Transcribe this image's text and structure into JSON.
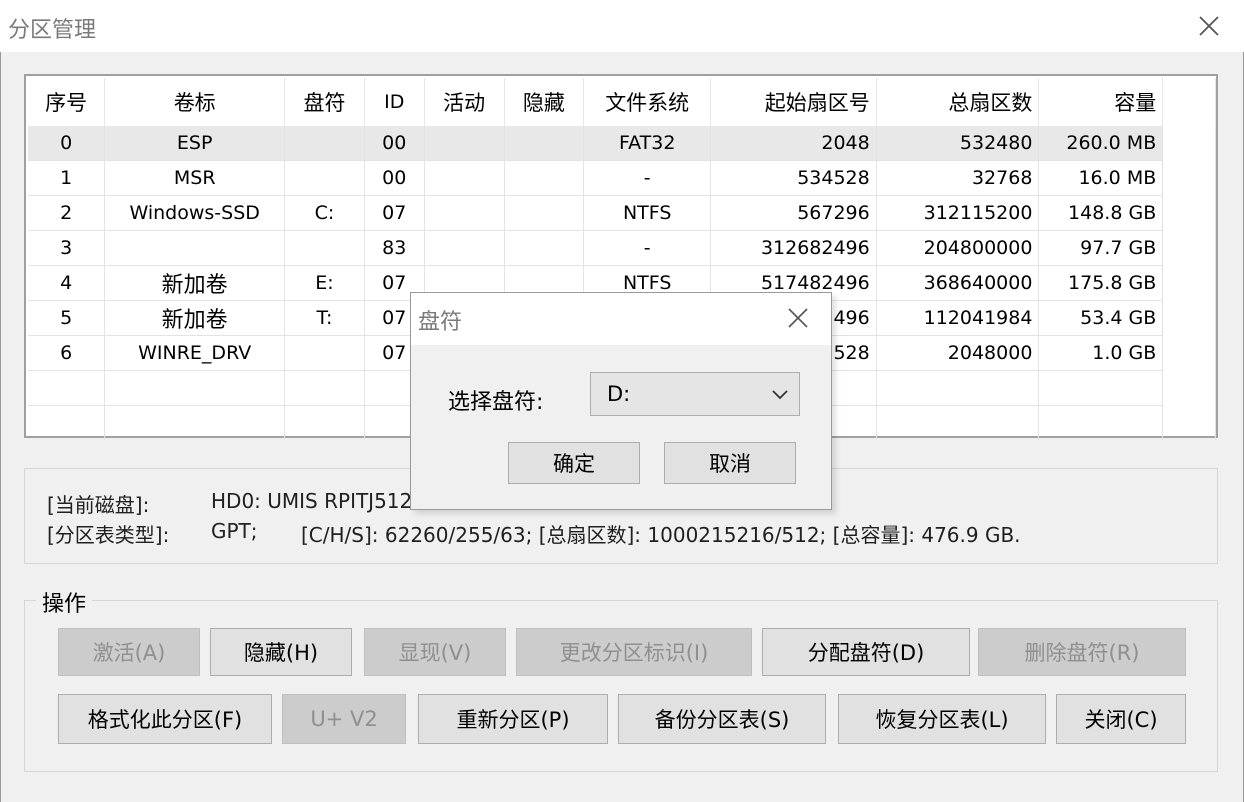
{
  "window": {
    "title": "分区管理"
  },
  "table": {
    "columns": [
      "序号",
      "卷标",
      "盘符",
      "ID",
      "活动",
      "隐藏",
      "文件系统",
      "起始扇区号",
      "总扇区数",
      "容量"
    ],
    "rows": [
      {
        "idx": "0",
        "label": "ESP",
        "drive": "",
        "id": "00",
        "active": "",
        "hidden": "",
        "fs": "FAT32",
        "start": "2048",
        "total": "532480",
        "size": "260.0 MB"
      },
      {
        "idx": "1",
        "label": "MSR",
        "drive": "",
        "id": "00",
        "active": "",
        "hidden": "",
        "fs": "-",
        "start": "534528",
        "total": "32768",
        "size": "16.0 MB"
      },
      {
        "idx": "2",
        "label": "Windows-SSD",
        "drive": "C:",
        "id": "07",
        "active": "",
        "hidden": "",
        "fs": "NTFS",
        "start": "567296",
        "total": "312115200",
        "size": "148.8 GB"
      },
      {
        "idx": "3",
        "label": "",
        "drive": "",
        "id": "83",
        "active": "",
        "hidden": "",
        "fs": "-",
        "start": "312682496",
        "total": "204800000",
        "size": "97.7 GB"
      },
      {
        "idx": "4",
        "label": "新加卷",
        "drive": "E:",
        "id": "07",
        "active": "",
        "hidden": "",
        "fs": "NTFS",
        "start": "517482496",
        "total": "368640000",
        "size": "175.8 GB"
      },
      {
        "idx": "5",
        "label": "新加卷",
        "drive": "T:",
        "id": "07",
        "active": "",
        "hidden": "",
        "fs": "",
        "start": "496",
        "total": "112041984",
        "size": "53.4 GB"
      },
      {
        "idx": "6",
        "label": "WINRE_DRV",
        "drive": "",
        "id": "07",
        "active": "",
        "hidden": "",
        "fs": "",
        "start": "528",
        "total": "2048000",
        "size": "1.0 GB"
      }
    ]
  },
  "info": {
    "disk_label": "[当前磁盘]:",
    "disk_value": "HD0: UMIS RPITJ512",
    "pt_label": "[分区表类型]:",
    "pt_value": "GPT;",
    "chs": "[C/H/S]: 62260/255/63; [总扇区数]: 1000215216/512; [总容量]: 476.9 GB."
  },
  "operations": {
    "legend": "操作",
    "activate": "激活(A)",
    "hide": "隐藏(H)",
    "show": "显现(V)",
    "change_id": "更改分区标识(I)",
    "assign_letter": "分配盘符(D)",
    "remove_letter": "删除盘符(R)",
    "format": "格式化此分区(F)",
    "uv2": "U+ V2",
    "repartition": "重新分区(P)",
    "backup_pt": "备份分区表(S)",
    "restore_pt": "恢复分区表(L)",
    "close": "关闭(C)"
  },
  "dialog": {
    "title": "盘符",
    "label": "选择盘符:",
    "selected": "D:",
    "ok": "确定",
    "cancel": "取消"
  }
}
